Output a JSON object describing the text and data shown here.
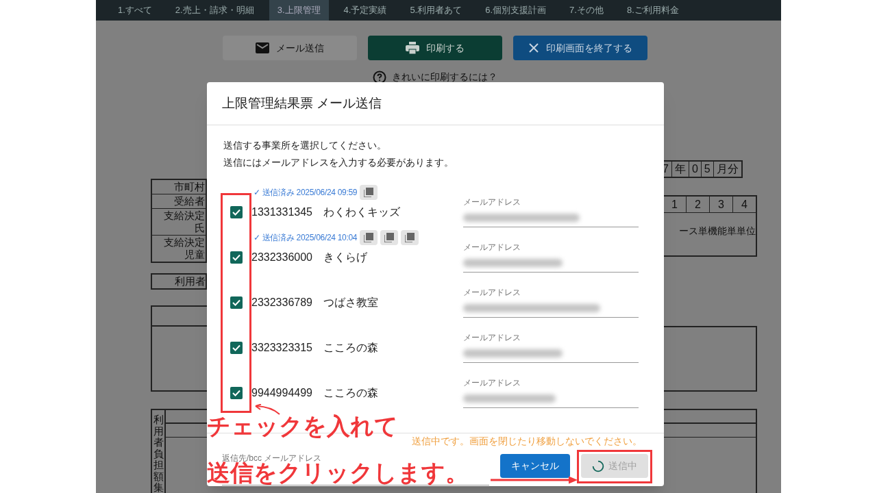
{
  "nav_tabs": [
    {
      "label": "1.すべて",
      "selected": false
    },
    {
      "label": "2.売上・請求・明細",
      "selected": false
    },
    {
      "label": "3.上限管理",
      "selected": true
    },
    {
      "label": "4.予定実績",
      "selected": false
    },
    {
      "label": "5.利用者あて",
      "selected": false
    },
    {
      "label": "6.個別支援計画",
      "selected": false
    },
    {
      "label": "7.その他",
      "selected": false
    },
    {
      "label": "8.ご利用料金",
      "selected": false
    }
  ],
  "toolbar": {
    "buttons": [
      {
        "kind": "mail",
        "label": "メール送信"
      },
      {
        "kind": "print",
        "label": "印刷する"
      },
      {
        "kind": "close",
        "label": "印刷画面を終了する"
      }
    ],
    "help_link": "きれいに印刷するには？"
  },
  "background_form": {
    "period": [
      "7",
      "年",
      "0",
      "5",
      "月分"
    ],
    "left_labels": [
      "市町村",
      "受給者",
      "支給決定",
      "氏",
      "支給決定",
      "児童"
    ],
    "user_label": "利用者",
    "numbers": [
      "1",
      "2",
      "3",
      "4"
    ],
    "service_text": "ース単機能単単位",
    "vertical_label": "利用者負担額集"
  },
  "dialog": {
    "title": "上限管理結果票 メール送信",
    "instructions": [
      "送信する事業所を選択してください。",
      "送信にはメールアドレスを入力する必要があります。"
    ],
    "offices": [
      {
        "code": "1331331345",
        "name": "わくわくキッズ",
        "checked": true,
        "sent": {
          "mark": "✓",
          "label": "送信済み",
          "time": "2025/06/24 09:59"
        },
        "attachments": [
          {
            "kind": "pdf"
          }
        ],
        "email_label": "メールアドレス"
      },
      {
        "code": "2332336000",
        "name": "きくらげ",
        "checked": true,
        "sent": {
          "mark": "✓",
          "label": "送信済み",
          "time": "2025/06/24 10:04"
        },
        "attachments": [
          {
            "kind": "pdf"
          },
          {
            "kind": "pdf"
          },
          {
            "kind": "pdf"
          }
        ],
        "email_label": "メールアドレス"
      },
      {
        "code": "2332336789",
        "name": "つばさ教室",
        "checked": true,
        "email_label": "メールアドレス"
      },
      {
        "code": "3323323315",
        "name": "こころの森",
        "checked": true,
        "email_label": "メールアドレス"
      },
      {
        "code": "9944994499",
        "name": "こころの森",
        "checked": true,
        "email_label": "メールアドレス"
      }
    ],
    "sending_message": "送信中です。画面を閉じたり移動しないでください。",
    "bcc_label": "返信先/bcc メールアドレス",
    "cancel_button": "キャンセル",
    "send_button": {
      "label": "送信中",
      "busy": true
    }
  },
  "annotation": {
    "lines": [
      "チェックを入れて",
      "送信をクリックします。"
    ]
  }
}
